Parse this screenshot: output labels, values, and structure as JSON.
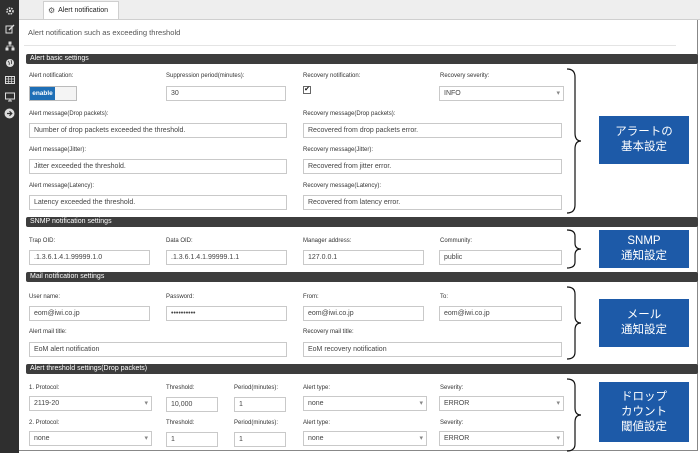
{
  "tab": {
    "title": "Alert notification"
  },
  "description": "Alert notification such as exceeding threshold",
  "sections": {
    "basic": "Alert basic settings",
    "snmp": "SNMP notification settings",
    "mail": "Mail notification settings",
    "threshold": "Alert threshold settings(Drop packets)"
  },
  "basic": {
    "alert_notification_label": "Alert notification:",
    "toggle_label": "enable",
    "suppression_label": "Suppression period(minutes):",
    "suppression_value": "30",
    "recovery_notification_label": "Recovery notification:",
    "recovery_notification_checked": "✔",
    "recovery_severity_label": "Recovery severity:",
    "recovery_severity_value": "INFO",
    "alert_drop_label": "Alert message(Drop packets):",
    "alert_drop_value": "Number of drop packets exceeded the threshold.",
    "recovery_drop_label": "Recovery message(Drop packets):",
    "recovery_drop_value": "Recovered from drop packets error.",
    "alert_jitter_label": "Alert message(Jitter):",
    "alert_jitter_value": "Jitter exceeded the threshold.",
    "recovery_jitter_label": "Recovery message(Jitter):",
    "recovery_jitter_value": "Recovered from jitter error.",
    "alert_latency_label": "Alert message(Latency):",
    "alert_latency_value": "Latency exceeded the threshold.",
    "recovery_latency_label": "Recovery message(Latency):",
    "recovery_latency_value": "Recovered from latency error."
  },
  "snmp": {
    "trap_label": "Trap OID:",
    "trap_value": ".1.3.6.1.4.1.99999.1.0",
    "data_label": "Data OID:",
    "data_value": ".1.3.6.1.4.1.99999.1.1",
    "manager_label": "Manager address:",
    "manager_value": "127.0.0.1",
    "community_label": "Community:",
    "community_value": "public"
  },
  "mail": {
    "user_label": "User name:",
    "user_value": "eom@iwi.co.jp",
    "password_label": "Password:",
    "password_value": "••••••••••",
    "from_label": "From:",
    "from_value": "eom@iwi.co.jp",
    "to_label": "To:",
    "to_value": "eom@iwi.co.jp",
    "alert_title_label": "Alert mail title:",
    "alert_title_value": "EoM alert notification",
    "recovery_title_label": "Recovery mail title:",
    "recovery_title_value": "EoM recovery notification"
  },
  "threshold": {
    "rows": [
      {
        "protocol_label": "1. Protocol:",
        "protocol_value": "2119-20",
        "threshold_label": "Threshold:",
        "threshold_value": "10,000",
        "period_label": "Period(minutes):",
        "period_value": "1",
        "alert_type_label": "Alert type:",
        "alert_type_value": "none",
        "severity_label": "Severity:",
        "severity_value": "ERROR"
      },
      {
        "protocol_label": "2. Protocol:",
        "protocol_value": "none",
        "threshold_label": "Threshold:",
        "threshold_value": "1",
        "period_label": "Period(minutes):",
        "period_value": "1",
        "alert_type_label": "Alert type:",
        "alert_type_value": "none",
        "severity_label": "Severity:",
        "severity_value": "ERROR"
      }
    ]
  },
  "callouts": {
    "basic": [
      "アラートの",
      "基本設定"
    ],
    "snmp": [
      "SNMP",
      "通知設定"
    ],
    "mail": [
      "メール",
      "通知設定"
    ],
    "threshold": [
      "ドロップ",
      "カウント",
      "閾値設定"
    ]
  },
  "colors": {
    "accent": "#1e6fb6",
    "callout": "#1d5aa8",
    "section_bar": "#3d3d3d",
    "sidebar": "#2f2f2f"
  }
}
